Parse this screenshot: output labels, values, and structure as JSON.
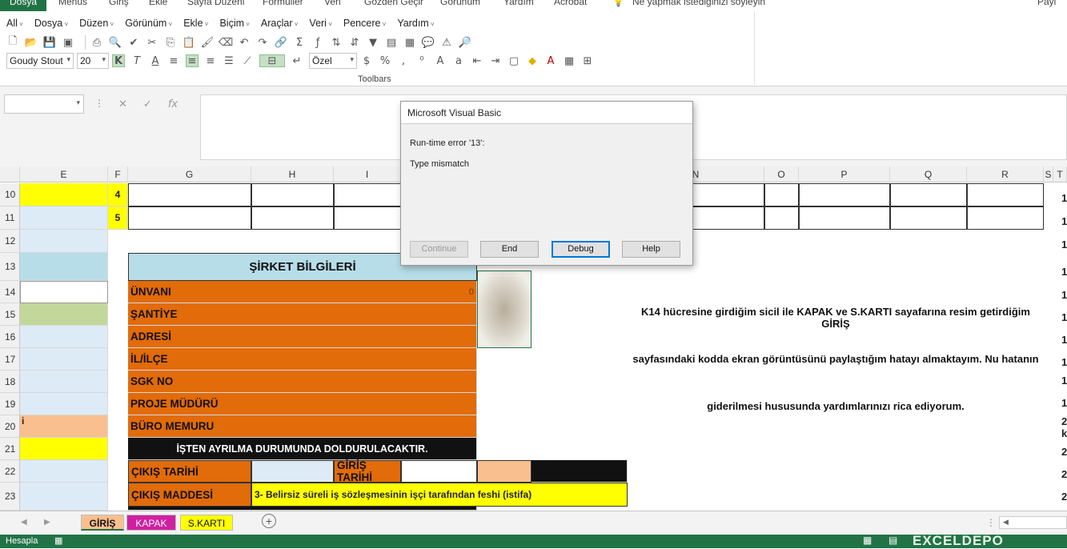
{
  "ribbon_tabs": [
    "Dosya",
    "Menus",
    "Giriş",
    "Ekle",
    "Sayfa Düzeni",
    "Formüller",
    "Veri",
    "Gözden Geçir",
    "Görünüm",
    "Yardım",
    "Acrobat",
    "Ne yapmak istediğinizi söyleyin",
    "Payl"
  ],
  "menu": [
    "All",
    "Dosya",
    "Düzen",
    "Görünüm",
    "Ekle",
    "Biçim",
    "Araçlar",
    "Veri",
    "Pencere",
    "Yardım"
  ],
  "font_name": "Goudy Stout",
  "font_size": "20",
  "number_format": "Özel",
  "toolbars_label": "Toolbars",
  "formula_bar": {
    "fx": "fx",
    "cancel": "✕",
    "enter": "✓"
  },
  "columns": [
    "E",
    "F",
    "G",
    "H",
    "I",
    "N",
    "O",
    "P",
    "Q",
    "R",
    "S",
    "T"
  ],
  "rows": [
    "10",
    "11",
    "12",
    "13",
    "14",
    "15",
    "16",
    "17",
    "18",
    "19",
    "20",
    "21",
    "22",
    "23"
  ],
  "cells": {
    "f10": "4",
    "f11": "5",
    "e20": "i",
    "title": "ŞİRKET BİLGİLERİ",
    "unvani": "ÜNVANI",
    "unvani_val": "0",
    "santiye": "ŞANTİYE",
    "adresi": "ADRESİ",
    "il_ilce": "İL/İLÇE",
    "sgk": "SGK NO",
    "proje": "PROJE MÜDÜRÜ",
    "buro": "BÜRO MEMURU",
    "isten": "İŞTEN AYRILMA DURUMUNDA DOLDURULACAKTIR.",
    "cikis_tarihi": "ÇIKIŞ TARİHİ",
    "giris_tarihi": "GİRİŞ TARİHİ",
    "cikis_maddesi": "ÇIKIŞ MADDESİ",
    "madde_val": "3- Belirsiz süreli iş sözleşmesinin işçi tarafından feshi (istifa)",
    "note1": "K14 hücresine girdiğim sicil ile KAPAK ve S.KARTI sayafarına resim getirdiğim GİRİŞ",
    "note2": "sayfasındaki kodda ekran görüntüsünü paylaştığım hatayı almaktayım. Nu hatanın",
    "note3": "giderilmesi hususunda yardımlarınızı rica ediyorum.",
    "t_col": [
      "1",
      "1",
      "1",
      "1",
      "1",
      "1",
      "1",
      "1",
      "1",
      "1",
      "2",
      "k",
      "2",
      "2",
      "2"
    ]
  },
  "dialog": {
    "title": "Microsoft Visual Basic",
    "error": "Run-time error '13':",
    "message": "Type mismatch",
    "buttons": [
      "Continue",
      "End",
      "Debug",
      "Help"
    ]
  },
  "sheet_tabs": [
    "GİRİŞ",
    "KAPAK",
    "S.KARTI"
  ],
  "status": {
    "mode": "Hesapla",
    "watermark": "EXCELDEPO"
  },
  "colors": {
    "excel_green": "#217346",
    "orange": "#e26b0a",
    "light_blue": "#ddebf7",
    "yellow": "#ffff00"
  }
}
